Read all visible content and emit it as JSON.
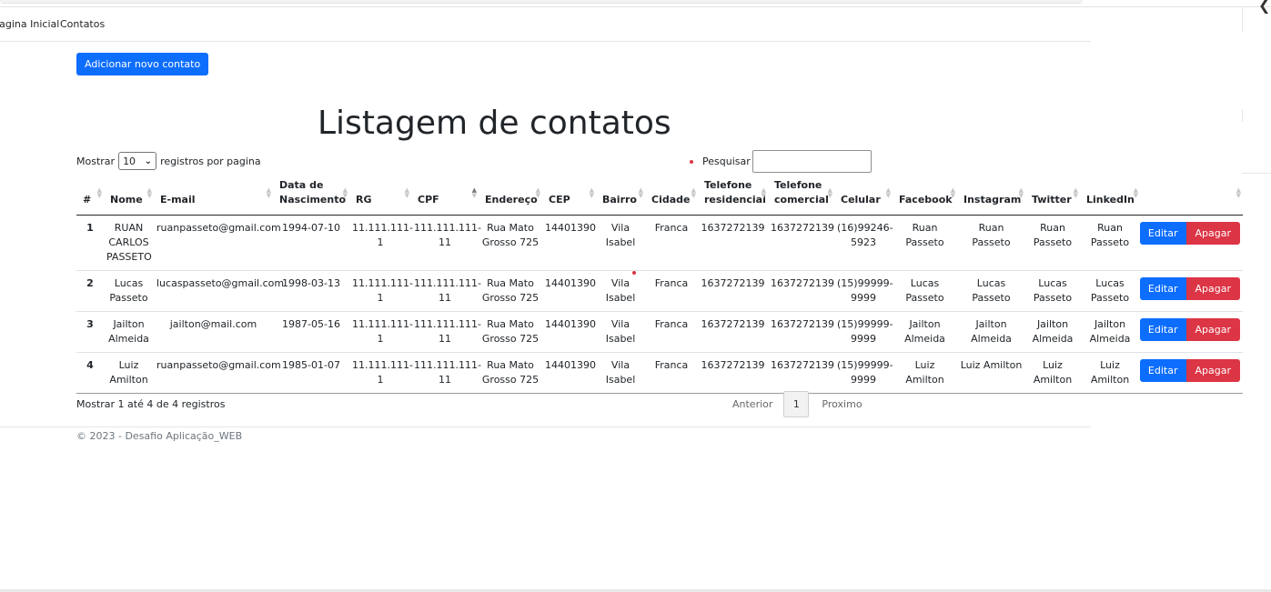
{
  "nav": {
    "home": "Pagina Inicial",
    "contacts": "Contatos"
  },
  "add_button": "Adicionar novo contato",
  "title": "Listagem de contatos",
  "length": {
    "before": "Mostrar",
    "value": "10",
    "after": "registros por pagina"
  },
  "search": {
    "label": "Pesquisar",
    "value": ""
  },
  "columns": [
    "#",
    "Nome",
    "E-mail",
    "Data de Nascimento",
    "RG",
    "CPF",
    "Endereço",
    "CEP",
    "Bairro",
    "Cidade",
    "Telefone residencial",
    "Telefone comercial",
    "Celular",
    "Facebook",
    "Instagram",
    "Twitter",
    "LinkedIn",
    ""
  ],
  "rows": [
    {
      "id": "1",
      "nome": "RUAN CARLOS PASSETO",
      "email": "ruanpasseto@gmail.com",
      "nasc": "1994-07-10",
      "rg": "11.111.111-1",
      "cpf": "111.111.111-11",
      "endereco": "Rua Mato Grosso 725",
      "cep": "14401390",
      "bairro": "Vila Isabel",
      "cidade": "Franca",
      "tel_res": "1637272139",
      "tel_com": "1637272139",
      "celular": "(16)99246-5923",
      "facebook": "Ruan Passeto",
      "instagram": "Ruan Passeto",
      "twitter": "Ruan Passeto",
      "linkedin": "Ruan Passeto",
      "edit": "Editar",
      "delete": "Apagar"
    },
    {
      "id": "2",
      "nome": "Lucas Passeto",
      "email": "lucaspasseto@gmail.com",
      "nasc": "1998-03-13",
      "rg": "11.111.111-1",
      "cpf": "111.111.111-11",
      "endereco": "Rua Mato Grosso 725",
      "cep": "14401390",
      "bairro": "Vila Isabel",
      "cidade": "Franca",
      "tel_res": "1637272139",
      "tel_com": "1637272139",
      "celular": "(15)99999-9999",
      "facebook": "Lucas Passeto",
      "instagram": "Lucas Passeto",
      "twitter": "Lucas Passeto",
      "linkedin": "Lucas Passeto",
      "edit": "Editar",
      "delete": "Apagar"
    },
    {
      "id": "3",
      "nome": "Jailton Almeida",
      "email": "jailton@mail.com",
      "nasc": "1987-05-16",
      "rg": "11.111.111-1",
      "cpf": "111.111.111-11",
      "endereco": "Rua Mato Grosso 725",
      "cep": "14401390",
      "bairro": "Vila Isabel",
      "cidade": "Franca",
      "tel_res": "1637272139",
      "tel_com": "1637272139",
      "celular": "(15)99999-9999",
      "facebook": "Jailton Almeida",
      "instagram": "Jailton Almeida",
      "twitter": "Jailton Almeida",
      "linkedin": "Jailton Almeida",
      "edit": "Editar",
      "delete": "Apagar"
    },
    {
      "id": "4",
      "nome": "Luiz Amilton",
      "email": "ruanpasseto@gmail.com",
      "nasc": "1985-01-07",
      "rg": "11.111.111-1",
      "cpf": "111.111.111-11",
      "endereco": "Rua Mato Grosso 725",
      "cep": "14401390",
      "bairro": "Vila Isabel",
      "cidade": "Franca",
      "tel_res": "1637272139",
      "tel_com": "1637272139",
      "celular": "(15)99999-9999",
      "facebook": "Luiz Amilton",
      "instagram": "Luiz Amilton",
      "twitter": "Luiz Amilton",
      "linkedin": "Luiz Amilton",
      "edit": "Editar",
      "delete": "Apagar"
    }
  ],
  "info": "Mostrar 1 até 4 de 4 registros",
  "pagination": {
    "prev": "Anterior",
    "page": "1",
    "next": "Proximo"
  },
  "footer": "© 2023 - Desafio Aplicação_WEB",
  "colors": {
    "primary": "#0d6efd",
    "danger": "#dc3545"
  }
}
